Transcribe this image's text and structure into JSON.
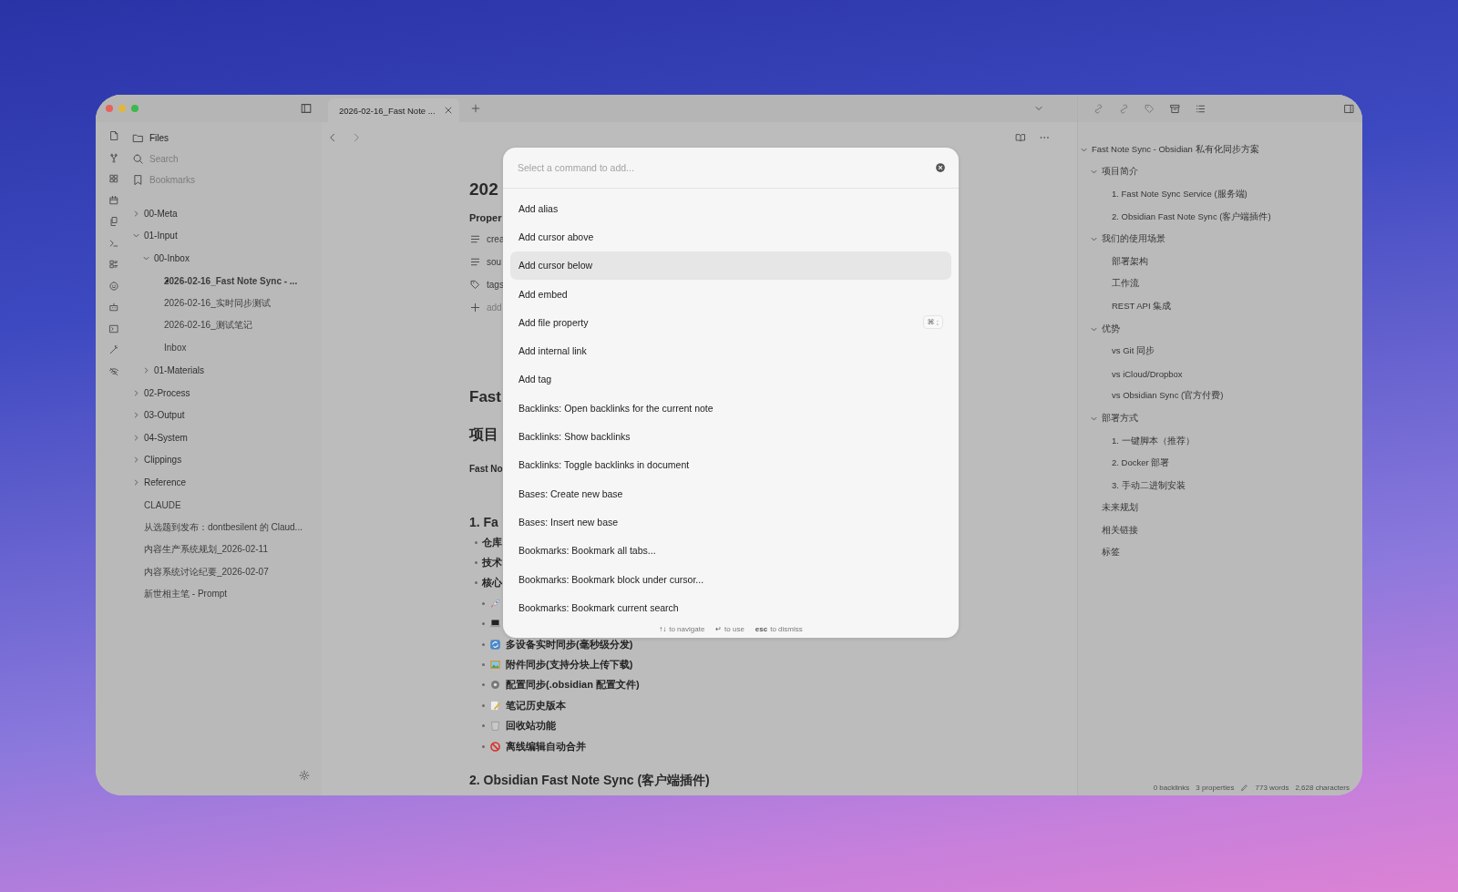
{
  "tabs": [
    {
      "label": "2026-02-16_Fast Note ...",
      "selected": true
    }
  ],
  "sidebar": {
    "nav": [
      {
        "label": "Files",
        "selected": true
      },
      {
        "label": "Search",
        "selected": false
      },
      {
        "label": "Bookmarks",
        "selected": false
      }
    ],
    "tree": [
      {
        "label": "00-Meta",
        "kind": "folder",
        "expanded": false,
        "selected": false
      },
      {
        "label": "01-Input",
        "kind": "folder",
        "expanded": true,
        "selected": false,
        "children": [
          {
            "label": "00-Inbox",
            "kind": "folder",
            "expanded": true,
            "selected": false,
            "children": [
              {
                "label": "2026-02-16_Fast Note Sync - ...",
                "kind": "file",
                "selected": true
              },
              {
                "label": "2026-02-16_实时同步测试",
                "kind": "file",
                "selected": false
              },
              {
                "label": "2026-02-16_测试笔记",
                "kind": "file",
                "selected": false
              },
              {
                "label": "Inbox",
                "kind": "file",
                "selected": false
              }
            ]
          },
          {
            "label": "01-Materials",
            "kind": "folder",
            "expanded": false,
            "selected": false
          }
        ]
      },
      {
        "label": "02-Process",
        "kind": "folder",
        "expanded": false,
        "selected": false
      },
      {
        "label": "03-Output",
        "kind": "folder",
        "expanded": false,
        "selected": false
      },
      {
        "label": "04-System",
        "kind": "folder",
        "expanded": false,
        "selected": false
      },
      {
        "label": "Clippings",
        "kind": "folder",
        "expanded": false,
        "selected": false
      },
      {
        "label": "Reference",
        "kind": "folder",
        "expanded": false,
        "selected": false
      },
      {
        "label": "CLAUDE",
        "kind": "file",
        "selected": false
      },
      {
        "label": "从选题到发布：dontbesilent 的 Claud...",
        "kind": "file",
        "selected": false
      },
      {
        "label": "内容生产系统规划_2026-02-11",
        "kind": "file",
        "selected": false
      },
      {
        "label": "内容系统讨论纪要_2026-02-07",
        "kind": "file",
        "selected": false
      },
      {
        "label": "新世相主笔 - Prompt",
        "kind": "file",
        "selected": false
      }
    ]
  },
  "editor": {
    "title": "202",
    "properties_label": "Proper",
    "properties": [
      {
        "kind": "text",
        "name": "crea"
      },
      {
        "kind": "text",
        "name": "sou"
      },
      {
        "kind": "tags",
        "name": "tags"
      },
      {
        "kind": "add",
        "name": "add"
      }
    ],
    "heading1": "Fast",
    "heading2": "项目",
    "paragraph": "Fast No",
    "section_heading": "1. Fa",
    "bullets": [
      {
        "text": "仓库"
      },
      {
        "text": "技术"
      },
      {
        "text": "核心",
        "children": [
          {
            "kind": "rocket"
          },
          {
            "kind": "laptop"
          },
          {
            "kind": "sync",
            "text": "多设备实时同步(毫秒级分发)"
          },
          {
            "kind": "image",
            "text": "附件同步(支持分块上传下载)"
          },
          {
            "kind": "gear",
            "text": "配置同步(.obsidian 配置文件)"
          },
          {
            "kind": "memo",
            "text": "笔记历史版本"
          },
          {
            "kind": "trash",
            "text": "回收站功能"
          },
          {
            "kind": "prohibited",
            "text": "离线编辑自动合并"
          }
        ]
      }
    ],
    "next_heading": "2. Obsidian Fast Note Sync (客户端插件)"
  },
  "command_palette": {
    "placeholder": "Select a command to add...",
    "items": [
      {
        "label": "Add alias",
        "selected": false
      },
      {
        "label": "Add cursor above",
        "selected": false
      },
      {
        "label": "Add cursor below",
        "selected": true
      },
      {
        "label": "Add embed",
        "selected": false
      },
      {
        "label": "Add file property",
        "selected": false,
        "hotkey": "⌘ ;"
      },
      {
        "label": "Add internal link",
        "selected": false
      },
      {
        "label": "Add tag",
        "selected": false
      },
      {
        "label": "Backlinks: Open backlinks for the current note",
        "selected": false
      },
      {
        "label": "Backlinks: Show backlinks",
        "selected": false
      },
      {
        "label": "Backlinks: Toggle backlinks in document",
        "selected": false
      },
      {
        "label": "Bases: Create new base",
        "selected": false
      },
      {
        "label": "Bases: Insert new base",
        "selected": false
      },
      {
        "label": "Bookmarks: Bookmark all tabs...",
        "selected": false
      },
      {
        "label": "Bookmarks: Bookmark block under cursor...",
        "selected": false
      },
      {
        "label": "Bookmarks: Bookmark current search",
        "selected": false
      }
    ],
    "hints": [
      {
        "keys": "↑↓",
        "text": "to navigate"
      },
      {
        "keys": "↵",
        "text": "to use"
      },
      {
        "keys": "esc",
        "text": "to dismiss"
      }
    ]
  },
  "outline": [
    {
      "text": "Fast Note Sync - Obsidian 私有化同步方案",
      "expanded": true,
      "children": [
        {
          "text": "项目简介",
          "expanded": true,
          "children": [
            {
              "text": "1. Fast Note Sync Service (服务端)"
            },
            {
              "text": "2. Obsidian Fast Note Sync (客户端插件)"
            }
          ]
        },
        {
          "text": "我们的使用场景",
          "expanded": true,
          "children": [
            {
              "text": "部署架构"
            },
            {
              "text": "工作流"
            },
            {
              "text": "REST API 集成"
            }
          ]
        },
        {
          "text": "优势",
          "expanded": true,
          "children": [
            {
              "text": "vs Git 同步"
            },
            {
              "text": "vs iCloud/Dropbox"
            },
            {
              "text": "vs Obsidian Sync (官方付费)"
            }
          ]
        },
        {
          "text": "部署方式",
          "expanded": true,
          "children": [
            {
              "text": "1. 一键脚本（推荐）"
            },
            {
              "text": "2. Docker 部署"
            },
            {
              "text": "3. 手动二进制安装"
            }
          ]
        },
        {
          "text": "未来规划"
        },
        {
          "text": "相关链接"
        },
        {
          "text": "标签"
        }
      ]
    }
  ],
  "status_bar": {
    "backlinks": "0 backlinks",
    "properties": "3 properties",
    "words": "773 words",
    "characters": "2,628 characters"
  }
}
